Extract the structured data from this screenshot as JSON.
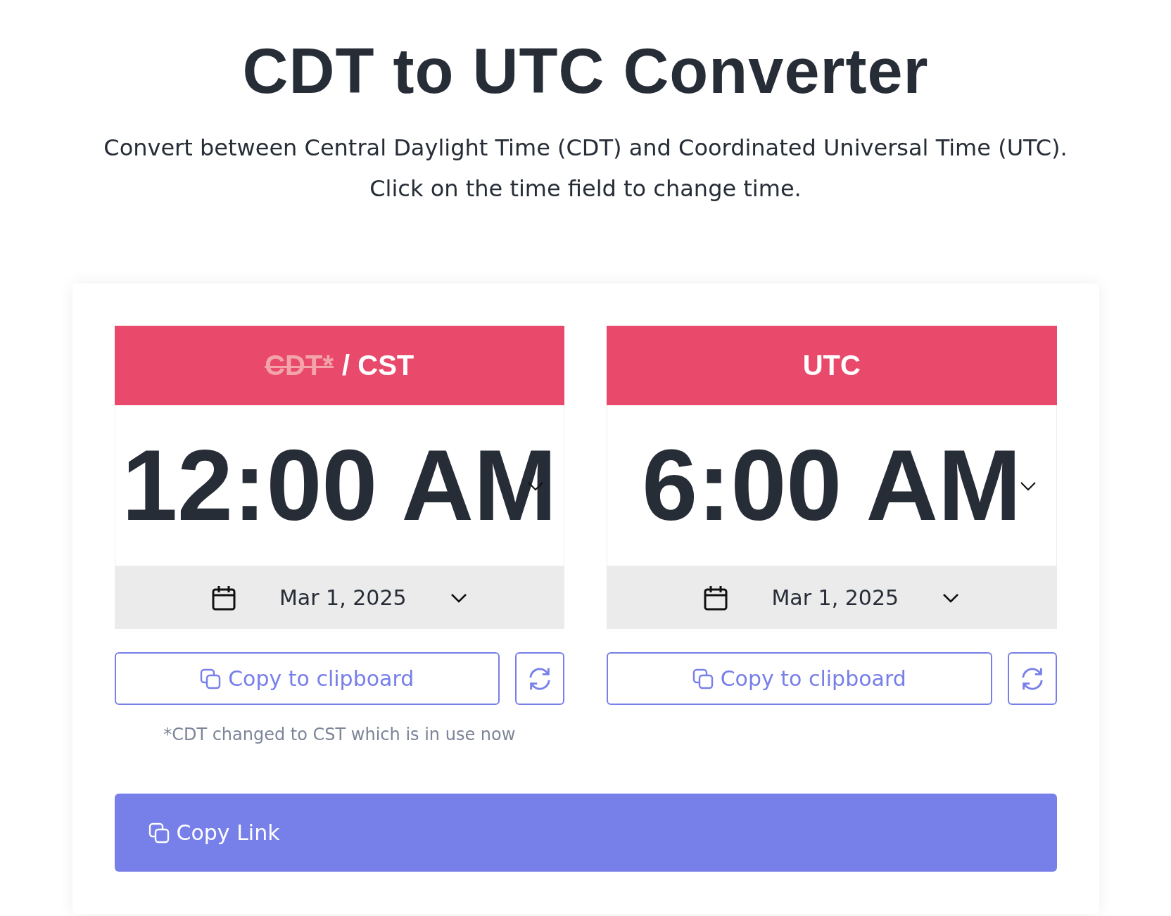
{
  "title": "CDT to UTC Converter",
  "subtitle": [
    "Convert between Central Daylight Time (CDT) and Coordinated Universal Time (UTC).",
    "Click on the time field to change time."
  ],
  "panels": [
    {
      "header": [
        {
          "text": "CDT*",
          "struck": true
        },
        {
          "text": "/ CST",
          "struck": false
        }
      ],
      "time": "12:00 AM",
      "date": "Mar 1, 2025",
      "copy_button": "Copy to clipboard",
      "note": "*CDT changed to CST which is in use now"
    },
    {
      "header": [
        {
          "text": "UTC",
          "struck": false
        }
      ],
      "time": "6:00 AM",
      "date": "Mar 1, 2025",
      "copy_button": "Copy to clipboard"
    }
  ],
  "copy_link": "Copy Link"
}
